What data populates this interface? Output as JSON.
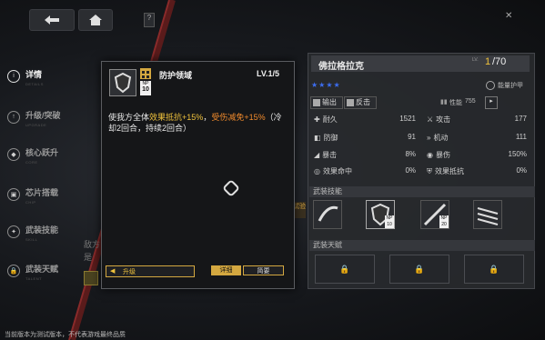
{
  "top": {
    "back_label": "",
    "home_label": ""
  },
  "nav": {
    "items": [
      {
        "label": "详情",
        "sub": "DETAILS",
        "icon": "info"
      },
      {
        "label": "升级/突破",
        "sub": "UPGRADE",
        "icon": "up"
      },
      {
        "label": "核心跃升",
        "sub": "CORE",
        "icon": "core"
      },
      {
        "label": "芯片搭载",
        "sub": "CHIP",
        "icon": "chip"
      },
      {
        "label": "武装技能",
        "sub": "SKILL",
        "icon": "skill"
      },
      {
        "label": "武装天赋",
        "sub": "TALENT",
        "icon": "lock"
      }
    ]
  },
  "character": {
    "name": "佛拉格拉克",
    "lv_label": "LV.",
    "level": "1",
    "max_level": "/70",
    "stars": "★★★★",
    "shield_label": "能量护甲",
    "role1": "输出",
    "role2": "反击",
    "perf_label": "性能",
    "perf_value": "755"
  },
  "stats": [
    {
      "l_label": "耐久",
      "l_val": "1521",
      "r_label": "攻击",
      "r_val": "177"
    },
    {
      "l_label": "防御",
      "l_val": "91",
      "r_label": "机动",
      "r_val": "111"
    },
    {
      "l_label": "暴击",
      "l_val": "8%",
      "r_label": "暴伤",
      "r_val": "150%"
    },
    {
      "l_label": "效果命中",
      "l_val": "0%",
      "r_label": "效果抵抗",
      "r_val": "0%"
    }
  ],
  "sections": {
    "skills_title": "武装技能",
    "talents_title": "武装天赋"
  },
  "skill_badges": [
    "",
    "NP 10",
    "",
    "NP 20",
    ""
  ],
  "popup": {
    "skill_name": "防护领域",
    "np_label": "NP",
    "np_value": "10",
    "level": "LV.1/5",
    "desc_1": "使我方全体",
    "desc_2": "效果抵抗+15%",
    "desc_3": "，",
    "desc_4": "受伤减免+15%",
    "desc_5": "（",
    "desc_6": "冷却2回合，持续2回合）",
    "upgrade_label": "升级",
    "tab_detail": "详细",
    "tab_brief": "简要"
  },
  "bg_text": {
    "line1": "敌方",
    "line2": "是",
    "tag": "试验"
  },
  "footer": "当前版本为测试版本，不代表游戏最终品质",
  "colors": {
    "accent": "#f0c23c",
    "highlight": "#f08a2c",
    "blue": "#3c6df0"
  }
}
